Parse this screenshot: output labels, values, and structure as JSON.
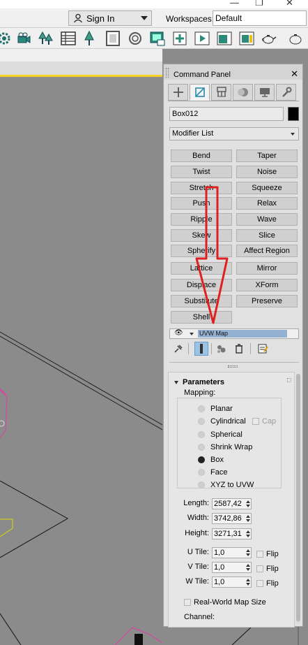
{
  "menubar": {
    "signin_label": "Sign In",
    "workspaces_label": "Workspaces:",
    "workspace_value": "Default"
  },
  "toolbar": {
    "icons": [
      "camera-icon",
      "tree-icon",
      "table-icon",
      "tree-icon",
      "frame-icon",
      "rotate-icon",
      "render-setup-icon",
      "render-frame-icon",
      "render-icon",
      "teapot-icon"
    ]
  },
  "panel": {
    "title": "Command Panel",
    "tabs": [
      "create-tab",
      "modify-tab",
      "hierarchy-tab",
      "motion-tab",
      "display-tab",
      "utilities-tab"
    ],
    "active_tab": "modify-tab",
    "object_name": "Box012",
    "object_color": "#000000",
    "modifier_list_label": "Modifier List",
    "modifier_buttons": [
      "Bend",
      "Taper",
      "Twist",
      "Noise",
      "Stretch",
      "Squeeze",
      "Push",
      "Relax",
      "Ripple",
      "Wave",
      "Skew",
      "Slice",
      "Spherify",
      "Affect Region",
      "Lattice",
      "Mirror",
      "Displace",
      "XForm",
      "Substitute",
      "Preserve",
      "Shell"
    ],
    "stack_item": "UVW Map"
  },
  "parameters": {
    "heading": "Parameters",
    "mapping_label": "Mapping:",
    "mapping_options": [
      "Planar",
      "Cylindrical",
      "Spherical",
      "Shrink Wrap",
      "Box",
      "Face",
      "XYZ to UVW"
    ],
    "selected_mapping": "Box",
    "cap_label": "Cap",
    "length_label": "Length:",
    "length_value": "2587,42",
    "width_label": "Width:",
    "width_value": "3742,86",
    "height_label": "Height:",
    "height_value": "3271,31",
    "u_tile_label": "U Tile:",
    "u_tile_value": "1,0",
    "v_tile_label": "V Tile:",
    "v_tile_value": "1,0",
    "w_tile_label": "W Tile:",
    "w_tile_value": "1,0",
    "flip_label": "Flip",
    "real_world_label": "Real-World Map Size",
    "channel_label": "Channel:"
  },
  "colors": {
    "annotation_arrow": "#e02020",
    "selection": "#94b1d1",
    "viewport_bg": "#8b8b8b"
  }
}
